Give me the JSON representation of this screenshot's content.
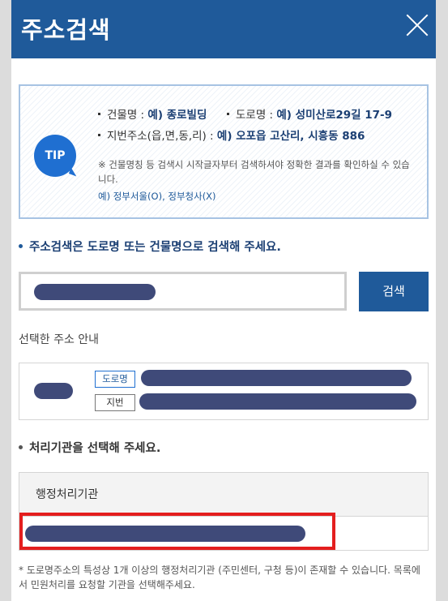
{
  "modal": {
    "title": "주소검색",
    "close_icon": "close-icon"
  },
  "tip": {
    "badge": "TIP",
    "line1_a_label": "건물명 : ",
    "line1_a_value": "예) 종로빌딩",
    "line1_b_label": "도로명 : ",
    "line1_b_value": "예) 성미산로29길 17-9",
    "line2_label": "지번주소(읍,면,동,리) : ",
    "line2_value": "예) 오포읍 고산리, 시흥동 886",
    "note": "※ 건물명칭 등 검색시 시작글자부터 검색하셔야 정확한 결과를 확인하실 수 있습니다.",
    "example": "예) 정부서울(O), 정부청사(X)"
  },
  "search": {
    "guide": "주소검색은 도로명 또는 건물명으로 검색해 주세요.",
    "button_label": "검색"
  },
  "selected": {
    "label": "선택한 주소 안내",
    "road_tag": "도로명",
    "lot_tag": "지번"
  },
  "agency": {
    "guide": "처리기관을 선택해 주세요.",
    "column_header": "행정처리기관"
  },
  "footnote": "* 도로명주소의 특성상 1개 이상의 행정처리기관 (주민센터, 구청 등)이 존재할 수 있습니다. 목록에서 민원처리를 요청할 기관을 선택해주세요.",
  "colors": {
    "header": "#1f5a9a",
    "highlight": "#e41e1e",
    "redaction": "#3f4a79"
  }
}
